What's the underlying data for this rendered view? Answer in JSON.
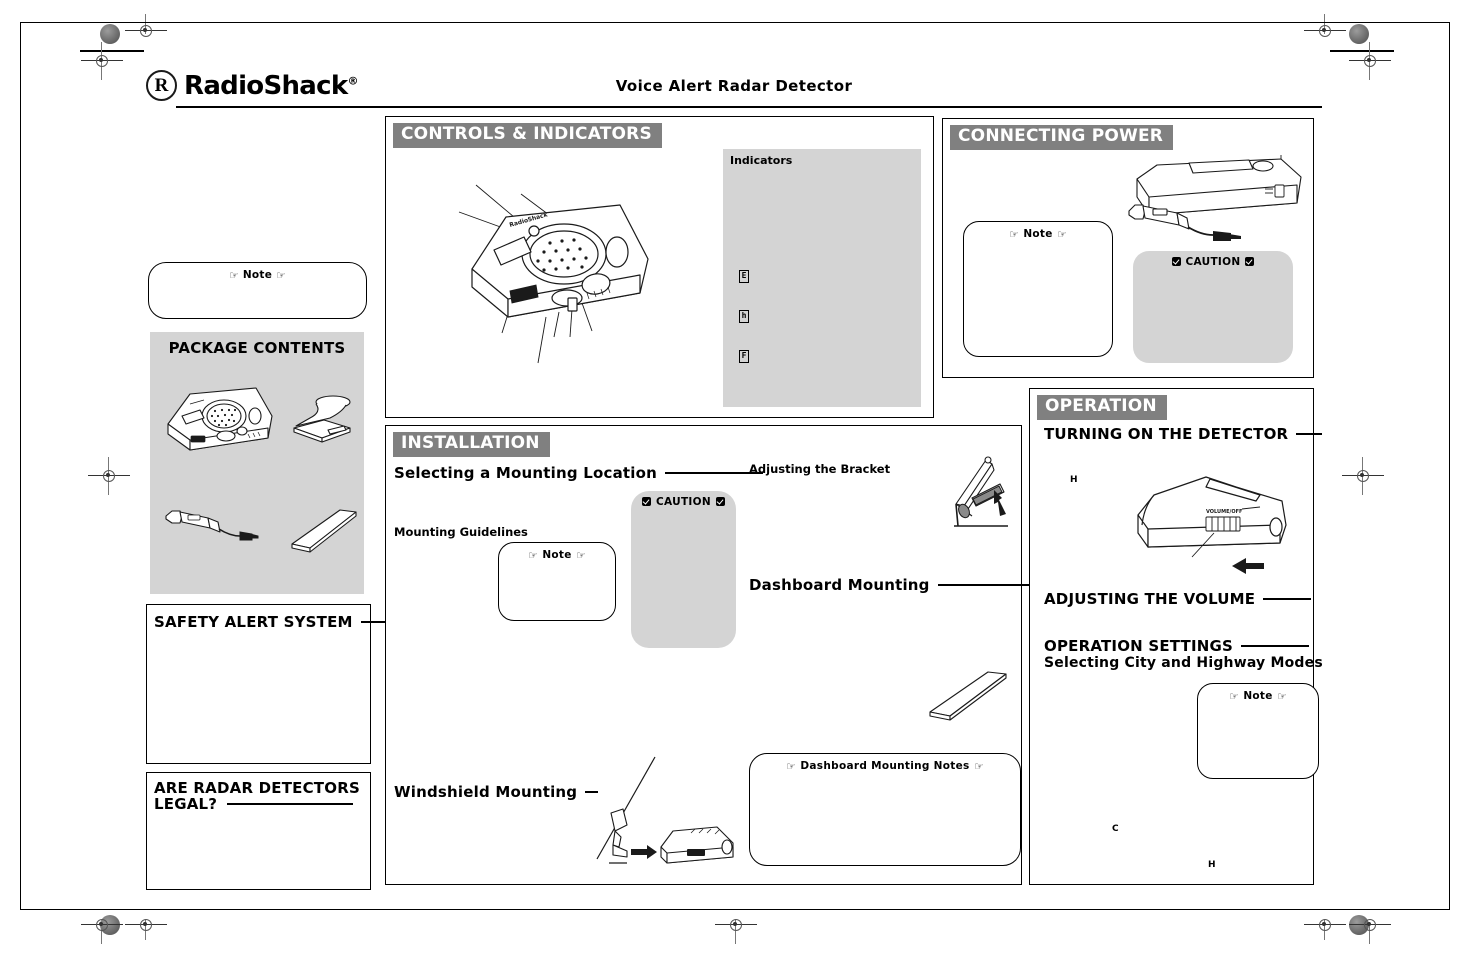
{
  "page": {
    "brand": "RadioShack",
    "brand_mark": "R",
    "brand_reg": "®",
    "title": "Voice Alert Radar Detector"
  },
  "left_column": {
    "note_box": {
      "label": "Note",
      "icon": "pointing-hand-icon"
    },
    "package_contents": {
      "title": "PACKAGE CONTENTS",
      "items": [
        "radar-detector-illustration",
        "windshield-bracket-illustration",
        "power-cord-illustration",
        "dashboard-pad-illustration"
      ]
    },
    "safety_alert_system": {
      "title": "SAFETY ALERT SYSTEM"
    },
    "legal": {
      "title_line1": "ARE RADAR DETECTORS",
      "title_line2": "LEGAL?"
    }
  },
  "controls_section": {
    "banner": "CONTROLS & INDICATORS",
    "artwork": "radar-detector-top-view-illustration",
    "indicators": {
      "title": "Indicators",
      "glyphs": [
        {
          "symbol": "E",
          "name": "indicator-glyph-e"
        },
        {
          "symbol": "h",
          "name": "indicator-glyph-h"
        },
        {
          "symbol": "F",
          "name": "indicator-glyph-f"
        }
      ]
    }
  },
  "installation_section": {
    "banner": "INSTALLATION",
    "heading_selecting": "Selecting a Mounting Location",
    "sub_mounting_guidelines": "Mounting Guidelines",
    "note_box": {
      "label": "Note",
      "icon": "pointing-hand-icon"
    },
    "caution_box": {
      "label": "CAUTION",
      "icon": "caution-icon"
    },
    "sub_adjusting_bracket": "Adjusting the Bracket",
    "heading_dashboard": "Dashboard Mounting",
    "heading_windshield": "Windshield Mounting",
    "dashboard_notes_box": {
      "label": "Dashboard Mounting Notes",
      "icon": "pointing-hand-icon"
    },
    "artwork": [
      "bracket-angle-adjust-illustration",
      "dashboard-pad-illustration",
      "windshield-mount-illustration"
    ]
  },
  "power_section": {
    "banner": "CONNECTING POWER",
    "note_box": {
      "label": "Note",
      "icon": "pointing-hand-icon"
    },
    "caution_box": {
      "label": "CAUTION",
      "icon": "caution-icon"
    },
    "artwork": [
      "detector-rear-view-illustration",
      "power-plug-illustration"
    ]
  },
  "operation_section": {
    "banner": "OPERATION",
    "heading_turning_on": "TURNING ON THE DETECTOR",
    "heading_volume": "ADJUSTING THE VOLUME",
    "heading_settings": "OPERATION SETTINGS",
    "subheading_modes": "Selecting City and Highway Modes",
    "note_box": {
      "label": "Note",
      "icon": "pointing-hand-icon"
    },
    "markers": [
      {
        "symbol": "H",
        "name": "marker-h-top"
      },
      {
        "symbol": "C",
        "name": "marker-c"
      },
      {
        "symbol": "H",
        "name": "marker-h-bottom"
      }
    ],
    "artwork": [
      "detector-side-view-volume-switch-illustration"
    ]
  },
  "colors": {
    "banner_gray": "#808080",
    "panel_gray": "#d4d4d4",
    "ink": "#000000",
    "paper": "#ffffff"
  }
}
